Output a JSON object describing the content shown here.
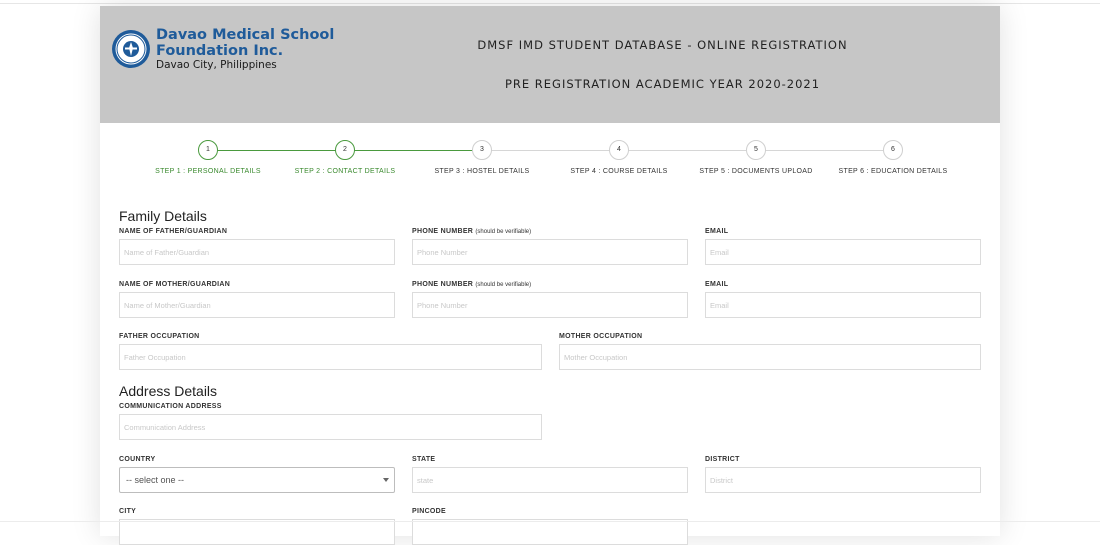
{
  "header": {
    "org_name": "Davao Medical School Foundation Inc.",
    "org_city": "Davao City, Philippines",
    "title": "DMSF IMD STUDENT DATABASE - ONLINE REGISTRATION",
    "subtitle": "PRE REGISTRATION ACADEMIC YEAR 2020-2021",
    "brand_color": "#1f5b9a",
    "header_bg": "#c6c6c6"
  },
  "steps": [
    {
      "number": "1",
      "label": "STEP 1 : PERSONAL DETAILS",
      "status": "completed"
    },
    {
      "number": "2",
      "label": "STEP 2 : CONTACT DETAILS",
      "status": "current"
    },
    {
      "number": "3",
      "label": "STEP 3 : HOSTEL DETAILS",
      "status": "pending"
    },
    {
      "number": "4",
      "label": "STEP 4 : COURSE DETAILS",
      "status": "pending"
    },
    {
      "number": "5",
      "label": "STEP 5 : DOCUMENTS UPLOAD",
      "status": "pending"
    },
    {
      "number": "6",
      "label": "STEP 6 : EDUCATION DETAILS",
      "status": "pending"
    }
  ],
  "step_colors": {
    "done": "#3a8a2e",
    "pending": "#cfcfcf"
  },
  "family": {
    "title": "Family Details",
    "father_name_label": "NAME OF FATHER/GUARDIAN",
    "father_name_placeholder": "Name of Father/Guardian",
    "father_phone_label": "PHONE NUMBER",
    "phone_note": "(should be verifiable)",
    "father_phone_placeholder": "Phone Number",
    "father_email_label": "EMAIL",
    "father_email_placeholder": "Email",
    "mother_name_label": "NAME OF MOTHER/GUARDIAN",
    "mother_name_placeholder": "Name of Mother/Guardian",
    "mother_phone_label": "PHONE NUMBER",
    "mother_phone_placeholder": "Phone Number",
    "mother_email_label": "EMAIL",
    "mother_email_placeholder": "Email",
    "father_occupation_label": "FATHER OCCUPATION",
    "father_occupation_placeholder": "Father Occupation",
    "mother_occupation_label": "MOTHER OCCUPATION",
    "mother_occupation_placeholder": "Mother Occupation"
  },
  "address": {
    "title": "Address Details",
    "comm_label": "COMMUNICATION ADDRESS",
    "comm_placeholder": "Communication Address",
    "country_label": "COUNTRY",
    "country_selected": "-- select one --",
    "state_label": "STATE",
    "state_placeholder": "state",
    "district_label": "DISTRICT",
    "district_placeholder": "District",
    "city_label": "CITY",
    "pincode_label": "PINCODE"
  }
}
